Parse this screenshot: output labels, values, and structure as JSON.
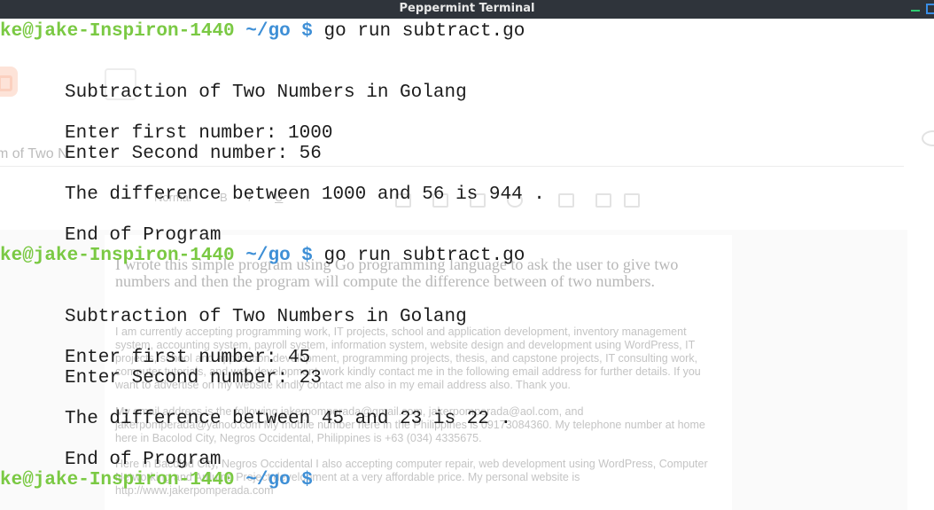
{
  "window": {
    "title": "Peppermint Terminal"
  },
  "background_window": {
    "doc_title": "m of Two N",
    "toolbar": {
      "style_label": "Normal",
      "bold": "B",
      "italic": "I",
      "underline": "U"
    },
    "lead_text": "I wrote this simple program using Go programming language to ask the user to give two numbers and then the program will compute the difference between of two numbers.",
    "paragraphs": [
      "I am currently accepting programming work, IT projects, school and application development, inventory management system, accounting system, payroll system, information system, website design and development using WordPress, IT projects, school and application development, programming projects, thesis, and capstone projects, IT consulting work, computer tutorials, and web development work kindly contact me in the following email address for further details. If you want to advertise on my website kindly contact me also in my email address also. Thank you.",
      "My email address is the following jakerpomperada@gmail.com, jakerpomperada@aol.com, and jakerpomperada@yahoo.com My mobile number here in the Philippines is 09173084360. My telephone number at home here in Bacolod City, Negros Occidental, Philippines is +63 (034) 4335675.",
      "Here in Bacolod City, Negros Occidental I also accepting computer repair, web development using WordPress, Computer Networking and Arduino Project development at a very affordable price. My personal website is http://www.jakerpomperada.com"
    ]
  },
  "terminal": {
    "prompt_user": "ke@jake-Inspiron-1440",
    "prompt_path": "~/go",
    "prompt_symbol": "$",
    "command": "go run subtract.go",
    "runs": [
      {
        "title": "Subtraction of Two Numbers in Golang",
        "first": "Enter first number: 1000",
        "second": "Enter Second number: 56",
        "result": "The difference between 1000 and 56 is 944 .",
        "end": "End of Program"
      },
      {
        "title": "Subtraction of Two Numbers in Golang",
        "first": "Enter first number: 45",
        "second": "Enter Second number: 23",
        "result": "The difference between 45 and 23 is 22 .",
        "end": "End of Program"
      }
    ]
  }
}
